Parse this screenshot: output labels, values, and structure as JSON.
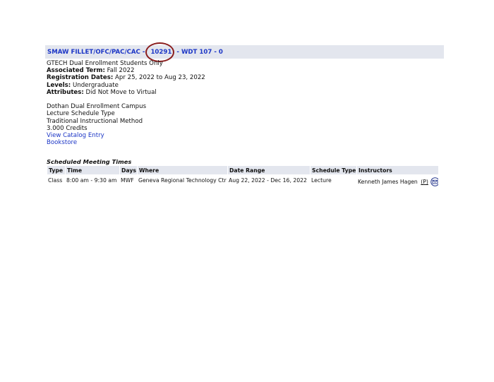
{
  "course": {
    "title": "SMAW FILLET/OFC/PAC/CAC",
    "separator": "-",
    "crn": "10291",
    "course_code": "WDT 107",
    "section": "0",
    "highlight_color": "#8a1c1c",
    "link_color": "#1c36c6"
  },
  "details": {
    "note": "GTECH Dual Enrollment Students Only",
    "associated_term_label": "Associated Term:",
    "associated_term_value": "Fall 2022",
    "registration_dates_label": "Registration Dates:",
    "registration_dates_value": "Apr 25, 2022 to Aug 23, 2022",
    "levels_label": "Levels:",
    "levels_value": "Undergraduate",
    "attributes_label": "Attributes:",
    "attributes_value": "Did Not Move to Virtual",
    "campus": "Dothan Dual Enrollment Campus",
    "schedule_type": "Lecture Schedule Type",
    "instructional_method": "Traditional Instructional Method",
    "credits": "3.000 Credits",
    "catalog_link": "View Catalog Entry",
    "bookstore_link": "Bookstore"
  },
  "meeting_times": {
    "caption": "Scheduled Meeting Times",
    "headers": {
      "type": "Type",
      "time": "Time",
      "days": "Days",
      "where": "Where",
      "date_range": "Date Range",
      "schedule_type": "Schedule Type",
      "instructors": "Instructors"
    },
    "rows": [
      {
        "type": "Class",
        "time": "8:00 am - 9:30 am",
        "days": "MWF",
        "where": "Geneva Regional Technology Ctr",
        "date_range": "Aug 22, 2022 - Dec 16, 2022",
        "schedule_type": "Lecture",
        "instructor": "Kenneth James Hagen",
        "instructor_role": "(P)",
        "icon": "email-icon"
      }
    ]
  }
}
